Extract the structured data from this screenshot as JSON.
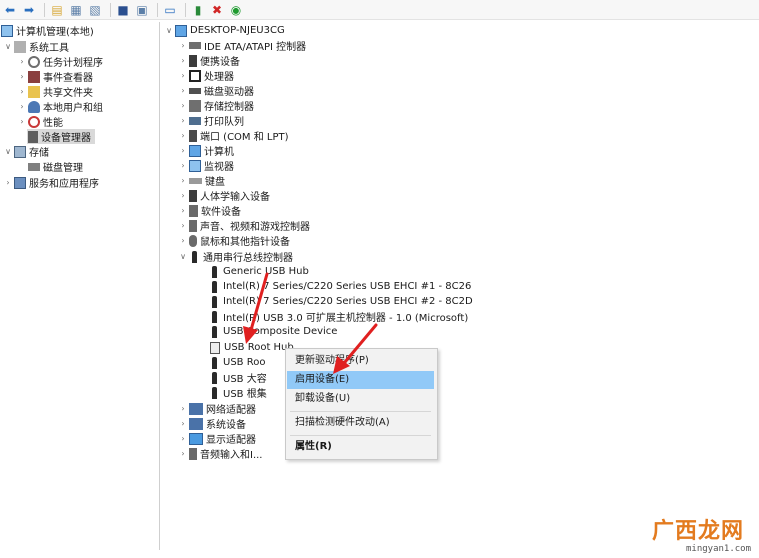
{
  "toolbar": {
    "icons": [
      "back-icon",
      "forward-icon",
      "up-folder-icon",
      "console-tree-icon",
      "export-list-icon",
      "help-icon",
      "properties-icon",
      "monitor-icon",
      "update-driver-icon",
      "uninstall-icon",
      "enable-device-icon"
    ],
    "colors": {
      "uninstall": "#d12727",
      "enable": "#1e9a2f"
    }
  },
  "left_tree": {
    "root": "计算机管理(本地)",
    "system_tools": "系统工具",
    "task_scheduler": "任务计划程序",
    "event_viewer": "事件查看器",
    "shared_folders": "共享文件夹",
    "local_users": "本地用户和组",
    "performance": "性能",
    "device_manager": "设备管理器",
    "storage": "存储",
    "disk_management": "磁盘管理",
    "services": "服务和应用程序"
  },
  "device_tree": {
    "computer_name": "DESKTOP-NJEU3CG",
    "categories": {
      "ide": "IDE ATA/ATAPI 控制器",
      "portable": "便携设备",
      "processors": "处理器",
      "disk_drives": "磁盘驱动器",
      "storage_ctl": "存储控制器",
      "print_queue": "打印队列",
      "ports": "端口 (COM 和 LPT)",
      "computer": "计算机",
      "monitors": "监视器",
      "keyboards": "键盘",
      "hid": "人体学输入设备",
      "software": "软件设备",
      "sound": "声音、视频和游戏控制器",
      "mice": "鼠标和其他指针设备",
      "usb": "通用串行总线控制器",
      "network": "网络适配器",
      "system": "系统设备",
      "display": "显示适配器",
      "audio_io": "音频输入和I..."
    },
    "usb_devices": {
      "generic_hub": "Generic USB Hub",
      "ehci1": "Intel(R) 7 Series/C220 Series USB EHCI #1 - 8C26",
      "ehci2": "Intel(R) 7 Series/C220 Series USB EHCI #2 - 8C2D",
      "xhci": "Intel(R) USB 3.0 可扩展主机控制器 - 1.0 (Microsoft)",
      "composite": "USB Composite Device",
      "root_hub_selected": "USB Root Hub",
      "root_hub_2": "USB Roo",
      "mass_storage": "USB 大容",
      "root_hub_3": "USB 根集"
    }
  },
  "context_menu": {
    "update_driver": "更新驱动程序(P)",
    "enable_device": "启用设备(E)",
    "uninstall_device": "卸载设备(U)",
    "scan_hardware": "扫描检测硬件改动(A)",
    "properties": "属性(R)",
    "highlight_color": "#91c9f7"
  },
  "watermark": {
    "brand": "广西龙网",
    "domain": "mingyan1.com",
    "color": "#e37b1f"
  },
  "annotation_color": "#e02020"
}
